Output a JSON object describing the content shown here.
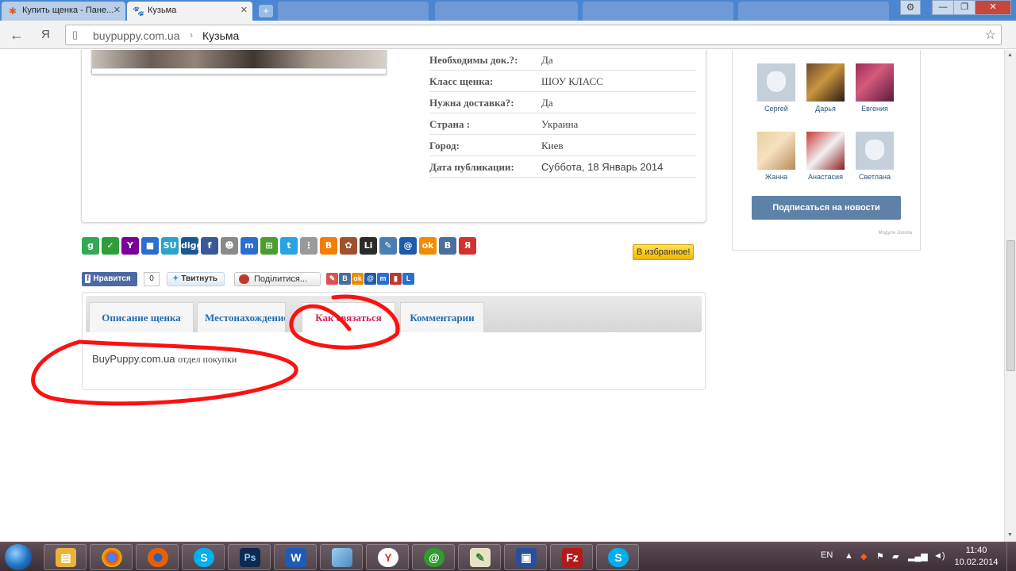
{
  "browser": {
    "tabs": [
      {
        "title": "Купить щенка - Пане...",
        "active": false
      },
      {
        "title": "Кузьма",
        "active": true
      }
    ],
    "address": {
      "host": "buypuppy.com.ua",
      "separator": "›",
      "path": "Кузьма"
    },
    "yandex_label": "Я"
  },
  "details": [
    {
      "label": "Необходимы док.?:",
      "value": "Да"
    },
    {
      "label": "Класс щенка:",
      "value": "ШОУ КЛАСС"
    },
    {
      "label": "Нужна доставка?:",
      "value": "Да"
    },
    {
      "label": "Страна :",
      "value": "Украина"
    },
    {
      "label": "Город:",
      "value": "Киев"
    },
    {
      "label": "Дата публикации:",
      "value": "Суббота, 18 Январь 2014"
    }
  ],
  "favorite_button": "В избранное!",
  "share_icons": [
    {
      "name": "google-bookmarks",
      "glyph": "g",
      "color": "#34a853"
    },
    {
      "name": "google-buzz",
      "glyph": "✓",
      "color": "#2e9e3a"
    },
    {
      "name": "yahoo",
      "glyph": "Y",
      "color": "#7b0099"
    },
    {
      "name": "delicious",
      "glyph": "■",
      "color": "#2a6fd0"
    },
    {
      "name": "stumbleupon",
      "glyph": "SU",
      "color": "#2aa4c9"
    },
    {
      "name": "digg",
      "glyph": "digg",
      "color": "#1b5891"
    },
    {
      "name": "facebook",
      "glyph": "f",
      "color": "#3b5998"
    },
    {
      "name": "reddit",
      "glyph": "☻",
      "color": "#8a8a8a"
    },
    {
      "name": "myspace",
      "glyph": "m",
      "color": "#2a6fd0"
    },
    {
      "name": "windows-live",
      "glyph": "⊞",
      "color": "#4a9d2f"
    },
    {
      "name": "twitter",
      "glyph": "t",
      "color": "#2aa3e2"
    },
    {
      "name": "print",
      "glyph": "⋮",
      "color": "#9a9a9a"
    },
    {
      "name": "blogger",
      "glyph": "B",
      "color": "#f57d00"
    },
    {
      "name": "memori",
      "glyph": "✿",
      "color": "#a0522d"
    },
    {
      "name": "linkedin",
      "glyph": "Li",
      "color": "#2b2b2b"
    },
    {
      "name": "bobrdobr",
      "glyph": "✎",
      "color": "#4a7fb5"
    },
    {
      "name": "mail-ru",
      "glyph": "@",
      "color": "#1e5ba8"
    },
    {
      "name": "odnoklassniki",
      "glyph": "ok",
      "color": "#f18c00"
    },
    {
      "name": "vkontakte",
      "glyph": "B",
      "color": "#4a6f9a"
    },
    {
      "name": "yandex",
      "glyph": "Я",
      "color": "#d2322d"
    }
  ],
  "social": {
    "fb_like": "Нравится",
    "fb_count": "0",
    "tweet": "Твитнуть",
    "share": "Поділитися...",
    "mini_icons": [
      {
        "name": "livejournal",
        "glyph": "✎",
        "color": "#d9534f"
      },
      {
        "name": "vkontakte",
        "glyph": "B",
        "color": "#4a6f9a"
      },
      {
        "name": "odnoklassniki",
        "glyph": "ok",
        "color": "#f18c00"
      },
      {
        "name": "mail-ru",
        "glyph": "@",
        "color": "#1e5ba8"
      },
      {
        "name": "myspace",
        "glyph": "m",
        "color": "#2a6fd0"
      },
      {
        "name": "friendfeed",
        "glyph": "▮",
        "color": "#c0392b"
      },
      {
        "name": "liveinternet",
        "glyph": "L",
        "color": "#2a6fd0"
      }
    ]
  },
  "page_tabs": [
    {
      "label": "Описание щенка",
      "active": false
    },
    {
      "label": "Местонахождение",
      "active": false
    },
    {
      "label": "Как связаться",
      "active": true
    },
    {
      "label": "Комментарии",
      "active": false
    }
  ],
  "contact": {
    "site": "BuyPuppy.com.ua",
    "dept": "отдел покупки"
  },
  "vk": {
    "members": [
      {
        "name": "Сергей",
        "avatar": "dog"
      },
      {
        "name": "Дарья",
        "avatar": "p1"
      },
      {
        "name": "Евгения",
        "avatar": "p2"
      },
      {
        "name": "Жанна",
        "avatar": "p3"
      },
      {
        "name": "Анастасия",
        "avatar": "p4"
      },
      {
        "name": "Светлана",
        "avatar": "dog"
      }
    ],
    "subscribe": "Подписаться на новости",
    "module_label": "Модули Joomla"
  },
  "taskbar": {
    "language": "EN",
    "time": "11:40",
    "date": "10.02.2014"
  }
}
